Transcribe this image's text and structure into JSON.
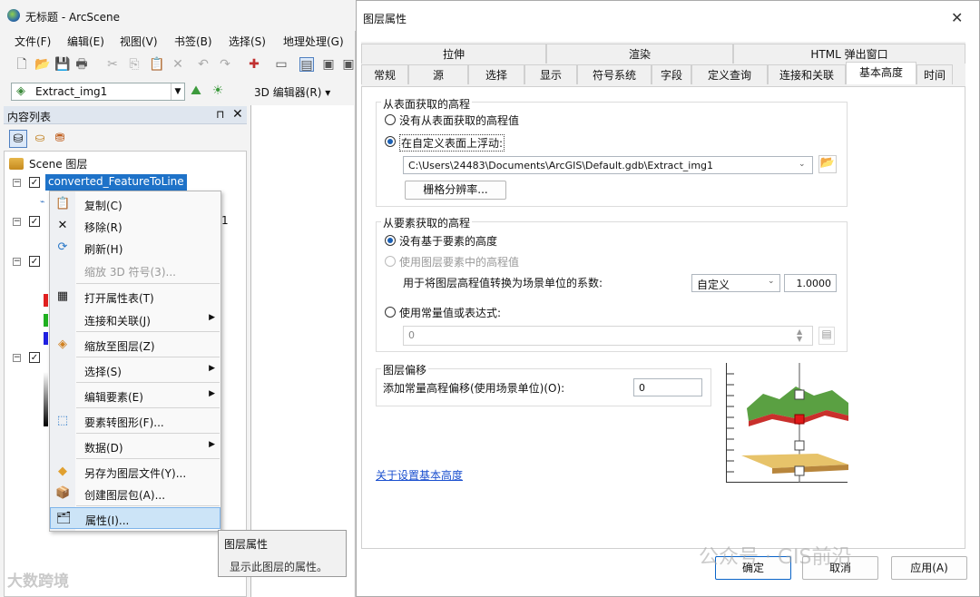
{
  "app": {
    "title": "无标题 - ArcScene",
    "menu": [
      "文件(F)",
      "编辑(E)",
      "视图(V)",
      "书签(B)",
      "选择(S)",
      "地理处理(G)"
    ],
    "layer_combo_value": "Extract_img1",
    "editor_label": "3D 编辑器(R) ▾"
  },
  "toc": {
    "title": "内容列表",
    "pin": "⊓",
    "close": "✕",
    "scene_label": "Scene 图层",
    "selected_layer": "converted_FeatureToLine",
    "partial_char": "1",
    "swatch_colors": [
      "#e02020",
      "#20b020",
      "#2020e0"
    ]
  },
  "context_menu": {
    "items": [
      {
        "label": "复制(C)",
        "icon": "copy-icon",
        "glyph": "📋",
        "disabled": false,
        "submenu": false
      },
      {
        "label": "移除(R)",
        "icon": "remove-icon",
        "glyph": "✕",
        "disabled": false,
        "submenu": false
      },
      {
        "label": "刷新(H)",
        "icon": "refresh-icon",
        "glyph": "⟳",
        "disabled": false,
        "submenu": false
      },
      {
        "label": "缩放 3D 符号(3)...",
        "icon": "",
        "glyph": "",
        "disabled": true,
        "submenu": false
      },
      {
        "label": "打开属性表(T)",
        "icon": "table-icon",
        "glyph": "▦",
        "disabled": false,
        "submenu": false
      },
      {
        "label": "连接和关联(J)",
        "icon": "",
        "glyph": "",
        "disabled": false,
        "submenu": true
      },
      {
        "label": "缩放至图层(Z)",
        "icon": "zoom-layer-icon",
        "glyph": "◈",
        "disabled": false,
        "submenu": false
      },
      {
        "label": "选择(S)",
        "icon": "",
        "glyph": "",
        "disabled": false,
        "submenu": true
      },
      {
        "label": "编辑要素(E)",
        "icon": "",
        "glyph": "",
        "disabled": false,
        "submenu": true
      },
      {
        "label": "要素转图形(F)...",
        "icon": "feature-to-graphic-icon",
        "glyph": "⬚",
        "disabled": false,
        "submenu": false
      },
      {
        "label": "数据(D)",
        "icon": "",
        "glyph": "",
        "disabled": false,
        "submenu": true
      },
      {
        "label": "另存为图层文件(Y)...",
        "icon": "save-layer-icon",
        "glyph": "◆",
        "disabled": false,
        "submenu": false
      },
      {
        "label": "创建图层包(A)...",
        "icon": "layer-package-icon",
        "glyph": "📦",
        "disabled": false,
        "submenu": false
      },
      {
        "label": "属性(I)...",
        "icon": "properties-icon",
        "glyph": "🗂",
        "disabled": false,
        "submenu": false
      }
    ],
    "submenu_arrow": "▶"
  },
  "tooltip": {
    "title": "图层属性",
    "text": "显示此图层的属性。"
  },
  "dialog": {
    "title": "图层属性",
    "close": "✕",
    "tabs_row1": [
      "拉伸",
      "渲染",
      "HTML 弹出窗口"
    ],
    "tabs_row2": [
      "常规",
      "源",
      "选择",
      "显示",
      "符号系统",
      "字段",
      "定义查询",
      "连接和关联",
      "基本高度",
      "时间"
    ],
    "active_tab": "基本高度",
    "surface_group": {
      "title": "从表面获取的高程",
      "option_none": "没有从表面获取的高程值",
      "option_float": "在自定义表面上浮动:",
      "surface_path": "C:\\Users\\24483\\Documents\\ArcGIS\\Default.gdb\\Extract_img1",
      "raster_res_button": "栅格分辨率..."
    },
    "feature_group": {
      "title": "从要素获取的高程",
      "option_none": "没有基于要素的高度",
      "option_layer": "使用图层要素中的高程值",
      "factor_label": "用于将图层高程值转换为场景单位的系数:",
      "factor_unit": "自定义",
      "factor_value": "1.0000",
      "option_expr": "使用常量值或表达式:",
      "expr_value": "0"
    },
    "offset_group": {
      "title": "图层偏移",
      "label": "添加常量高程偏移(使用场景单位)(O):",
      "value": "0"
    },
    "help_link": "关于设置基本高度",
    "buttons": {
      "ok": "确定",
      "cancel": "取消",
      "apply": "应用(A)"
    }
  },
  "watermarks": {
    "left": "大数跨境",
    "right": "公众号 · GIS前沿"
  }
}
